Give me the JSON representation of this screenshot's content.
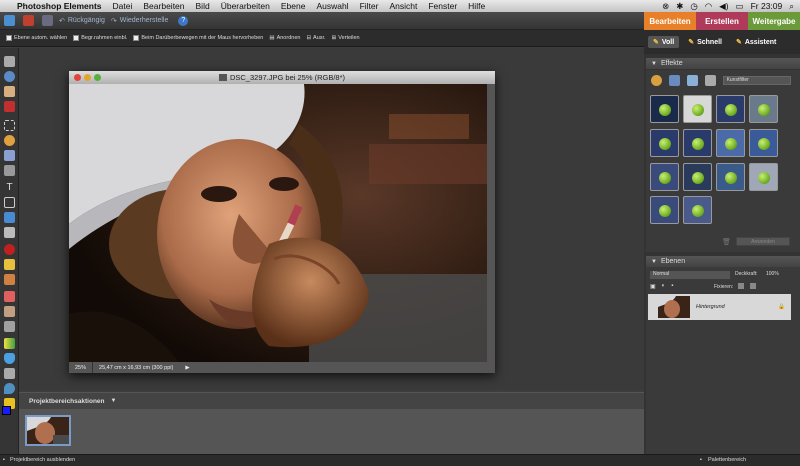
{
  "menubar": {
    "app_name": "Photoshop Elements",
    "items": [
      "Datei",
      "Bearbeiten",
      "Bild",
      "Überarbeiten",
      "Ebene",
      "Auswahl",
      "Filter",
      "Ansicht",
      "Fenster",
      "Hilfe"
    ],
    "clock": "Fr 23:09"
  },
  "appbar": {
    "undo_label": "Rückgängig",
    "redo_label": "Wiederherstelle",
    "help_label": "?"
  },
  "mode_tabs": [
    {
      "label": "Bearbeiten",
      "color": "#e8802a"
    },
    {
      "label": "Erstellen",
      "color": "#b03a5a"
    },
    {
      "label": "Weitergabe",
      "color": "#6a9a3a"
    }
  ],
  "options_bar": {
    "auto_select": "Ebene autom. wählen",
    "bounding_box": "Begr.rahmen einbl.",
    "hover_highlight": "Beim Darüberbewegen mit der Maus hervorheben",
    "arrange": "Anordnen",
    "align": "Ausr.",
    "distribute": "Verteilen"
  },
  "document": {
    "title": "DSC_3297.JPG bei 25% (RGB/8*)",
    "zoom": "25%",
    "dimensions": "25,47 cm x 16,93 cm (300 ppi)"
  },
  "project_bin": {
    "title": "Projektbereichsaktionen",
    "hide_label": "Projektbereich ausblenden"
  },
  "palette_label": "Palettenbereich",
  "right_panel": {
    "mode_buttons": [
      "Voll",
      "Schnell",
      "Assistent"
    ],
    "effects": {
      "title": "Effekte",
      "filter_dropdown": "Kunstfilter",
      "apply_label": "Anwenden"
    },
    "layers": {
      "title": "Ebenen",
      "blend_mode": "Normal",
      "opacity_label": "Deckkraft:",
      "opacity_value": "100%",
      "lock_label": "Fixieren:",
      "layer_name": "Hintergrund"
    }
  },
  "colors": {
    "foreground": "#1a1aff",
    "background": "#ffffff"
  }
}
